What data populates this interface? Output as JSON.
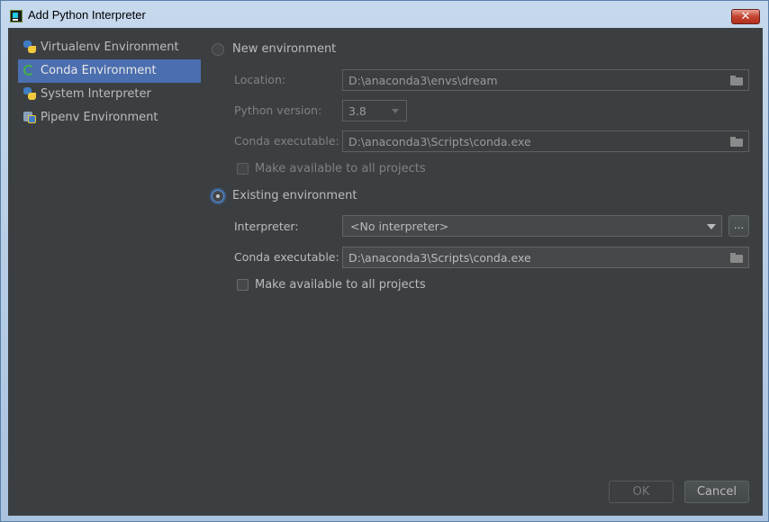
{
  "window": {
    "title": "Add Python Interpreter",
    "close_symbol": "✕"
  },
  "sidebar": {
    "items": [
      {
        "label": "Virtualenv Environment",
        "icon": "python-icon",
        "selected": false
      },
      {
        "label": "Conda Environment",
        "icon": "conda-icon",
        "selected": true
      },
      {
        "label": "System Interpreter",
        "icon": "python-icon",
        "selected": false
      },
      {
        "label": "Pipenv Environment",
        "icon": "pipenv-icon",
        "selected": false
      }
    ]
  },
  "new_env": {
    "radio_label": "New environment",
    "selected": false,
    "location_label": "Location:",
    "location_value": "D:\\anaconda3\\envs\\dream",
    "python_version_label": "Python version:",
    "python_version_value": "3.8",
    "conda_exec_label": "Conda executable:",
    "conda_exec_value": "D:\\anaconda3\\Scripts\\conda.exe",
    "make_available_label": "Make available to all projects",
    "make_available_checked": false
  },
  "existing_env": {
    "radio_label": "Existing environment",
    "selected": true,
    "interpreter_label": "Interpreter:",
    "interpreter_value": "<No interpreter>",
    "browse_label": "...",
    "conda_exec_label": "Conda executable:",
    "conda_exec_value": "D:\\anaconda3\\Scripts\\conda.exe",
    "make_available_label": "Make available to all projects",
    "make_available_checked": false
  },
  "buttons": {
    "ok": "OK",
    "cancel": "Cancel"
  },
  "colors": {
    "background": "#3c3f41",
    "selection": "#4b6eaf",
    "text": "#bbbbbb",
    "disabled_text": "#808080",
    "close_button": "#c4432f"
  }
}
